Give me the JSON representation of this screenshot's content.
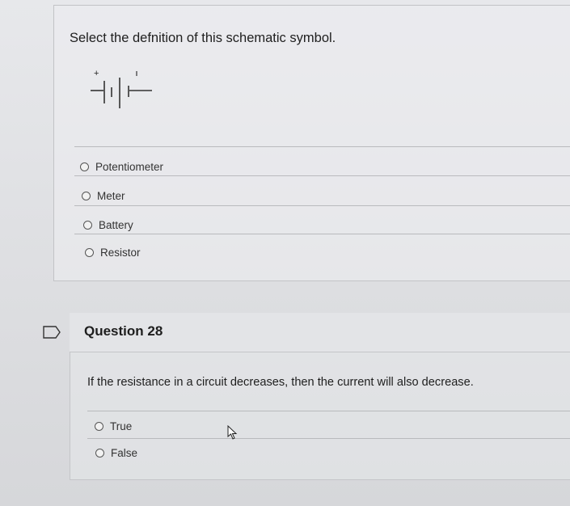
{
  "question27": {
    "prompt": "Select the defnition of this schematic symbol.",
    "schematic": {
      "icon": "battery-symbol-icon",
      "plus_label": "+"
    },
    "options": [
      {
        "label": "Potentiometer",
        "selected": false
      },
      {
        "label": "Meter",
        "selected": false
      },
      {
        "label": "Battery",
        "selected": false
      },
      {
        "label": "Resistor",
        "selected": false
      }
    ]
  },
  "question28": {
    "title": "Question 28",
    "flag_icon": "flag-icon",
    "prompt": "If the resistance in a circuit decreases, then the current will also decrease.",
    "options": [
      {
        "label": "True",
        "selected": false
      },
      {
        "label": "False",
        "selected": false
      }
    ]
  },
  "colors": {
    "background": "#d9dadd",
    "text": "#222222",
    "divider": "#b9babd"
  }
}
